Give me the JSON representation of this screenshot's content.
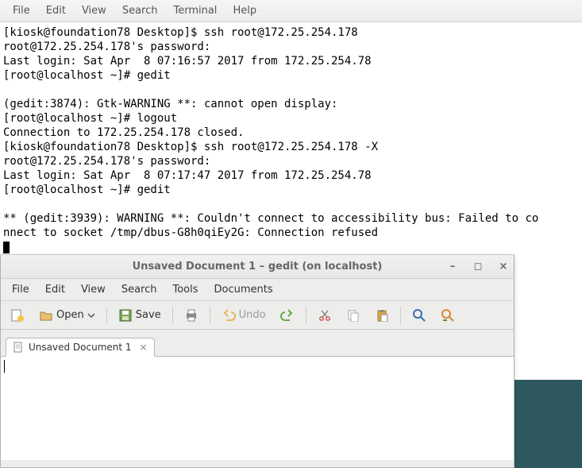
{
  "terminal": {
    "menu": [
      "File",
      "Edit",
      "View",
      "Search",
      "Terminal",
      "Help"
    ],
    "lines": [
      "[kiosk@foundation78 Desktop]$ ssh root@172.25.254.178",
      "root@172.25.254.178's password: ",
      "Last login: Sat Apr  8 07:16:57 2017 from 172.25.254.78",
      "[root@localhost ~]# gedit",
      "",
      "(gedit:3874): Gtk-WARNING **: cannot open display: ",
      "[root@localhost ~]# logout",
      "Connection to 172.25.254.178 closed.",
      "[kiosk@foundation78 Desktop]$ ssh root@172.25.254.178 -X",
      "root@172.25.254.178's password: ",
      "Last login: Sat Apr  8 07:17:47 2017 from 172.25.254.78",
      "[root@localhost ~]# gedit",
      "",
      "** (gedit:3939): WARNING **: Couldn't connect to accessibility bus: Failed to co",
      "nnect to socket /tmp/dbus-G8h0qiEy2G: Connection refused"
    ]
  },
  "gedit": {
    "title": "Unsaved Document 1 – gedit (on localhost)",
    "menu": [
      "File",
      "Edit",
      "View",
      "Search",
      "Tools",
      "Documents"
    ],
    "toolbar": {
      "open": "Open",
      "save": "Save",
      "undo": "Undo"
    },
    "tab": {
      "label": "Unsaved Document 1"
    }
  }
}
